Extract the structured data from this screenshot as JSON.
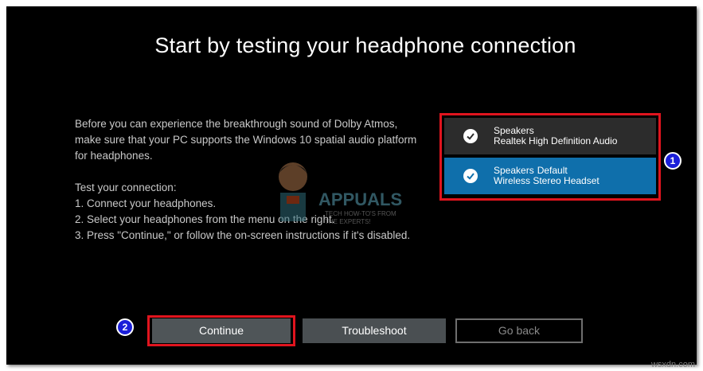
{
  "title": "Start by testing your headphone connection",
  "description": {
    "intro": "Before you can experience the breakthrough sound of Dolby Atmos, make sure that your PC supports the Windows 10 spatial audio platform for headphones.",
    "test_heading": "Test your connection:",
    "steps": [
      "1. Connect your headphones.",
      "2. Select your headphones from the menu on the right.",
      "3. Press \"Continue,\" or follow the on-screen instructions if it's disabled."
    ]
  },
  "devices": [
    {
      "name": "Speakers",
      "tag": "",
      "detail": "Realtek High Definition Audio",
      "selected": false
    },
    {
      "name": "Speakers",
      "tag": "Default",
      "detail": "Wireless Stereo Headset",
      "selected": true
    }
  ],
  "annotations": {
    "badge1": "1",
    "badge2": "2"
  },
  "buttons": {
    "continue": "Continue",
    "troubleshoot": "Troubleshoot",
    "go_back": "Go back"
  },
  "watermark": {
    "brand": "APPUALS",
    "tagline_1": "TECH HOW-TO'S FROM",
    "tagline_2": "THE EXPERTS!"
  },
  "site": "wsxdn.com",
  "colors": {
    "background": "#000000",
    "selected_item": "#0f6fab",
    "unselected_item": "#2c2c2c",
    "highlight_box": "#e0141e",
    "badge": "#1b1fd9"
  }
}
